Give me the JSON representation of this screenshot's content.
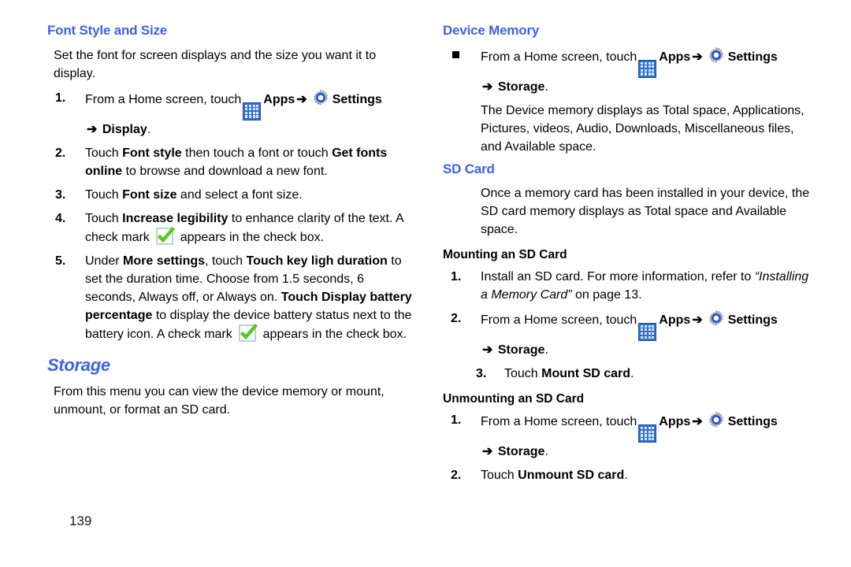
{
  "page": {
    "number": "139",
    "accent_color": "#3b62ee",
    "check_color": "#55cc22",
    "apps_icon_color": "#2f6fd0"
  },
  "icons": {
    "apps": "apps-grid-icon",
    "settings": "settings-gear-icon",
    "arrow": "➔",
    "check": "green-check-icon",
    "bullet": "square-bullet"
  },
  "left_column": {
    "heading": "Font Style and Size",
    "intro": "Set the font for screen displays and the size you want it to display.",
    "steps": [
      {
        "marker": "1.",
        "pre_apps": "From a Home screen, touch",
        "apps_label": "Apps",
        "settings_label": "Settings",
        "tail_label": "Display",
        "tail_period": "."
      },
      {
        "marker": "2.",
        "t1": "Touch ",
        "b1": "Font style",
        "t2": " then touch a font or touch ",
        "b2": "Get fonts online",
        "t3": " to browse and download a new font."
      },
      {
        "marker": "3.",
        "t1": "Touch ",
        "b1": "Font size",
        "t2": " and select a font size."
      },
      {
        "marker": "4.",
        "t1": "Touch ",
        "b1": "Increase legibility",
        "t2": " to enhance clarity of the text. A check mark ",
        "t3": " appears in the check box."
      },
      {
        "marker": "5.",
        "t1": "Under ",
        "b1": "More settings",
        "t2": ", touch ",
        "b2": "Touch key ligh duration",
        "t3": " to set the duration time. Choose from 1.5 seconds, 6 seconds, Always off, or Always on.",
        "b3": "Touch Display battery percentage",
        "t4": " to display the device battery status next to the battery icon. A check mark ",
        "t5": " appears in the check box."
      }
    ],
    "storage_heading": "Storage",
    "storage_text": "From this menu you can view the device memory or mount, unmount, or format an SD card."
  },
  "right_column": {
    "device_memory_heading": "Device Memory",
    "device_memory_step": {
      "pre_apps": "From a Home screen, touch",
      "apps_label": "Apps",
      "settings_label": "Settings",
      "tail_label": "Storage",
      "tail_period": "."
    },
    "device_memory_detail": "The Device memory displays as Total space, Applications, Pictures, videos, Audio, Downloads, Miscellaneous files, and Available space.",
    "sd_card_heading": "SD Card",
    "sd_card_text": "Once a memory card has been installed in your device, the SD card memory displays as Total space and Available space.",
    "mounting_heading": "Mounting an SD Card",
    "mounting_steps": [
      {
        "marker": "1.",
        "t1": "Install an SD card. For more information, refer to ",
        "ital": "“Installing a Memory Card”",
        "t2": " on page 13."
      },
      {
        "marker": "2.",
        "pre_apps": "From a Home screen, touch",
        "apps_label": "Apps",
        "settings_label": "Settings",
        "tail_label": "Storage",
        "tail_period": "."
      },
      {
        "marker": "3.",
        "t1": "Touch ",
        "b1": "Mount SD card",
        "t2": "."
      }
    ],
    "unmounting_heading": "Unmounting an SD Card",
    "unmounting_steps": [
      {
        "marker": "1.",
        "pre_apps": "From a Home screen, touch",
        "apps_label": "Apps",
        "settings_label": "Settings",
        "tail_label": "Storage",
        "tail_period": "."
      },
      {
        "marker": "2.",
        "t1": "Touch ",
        "b1": "Unmount SD card",
        "t2": "."
      }
    ]
  }
}
